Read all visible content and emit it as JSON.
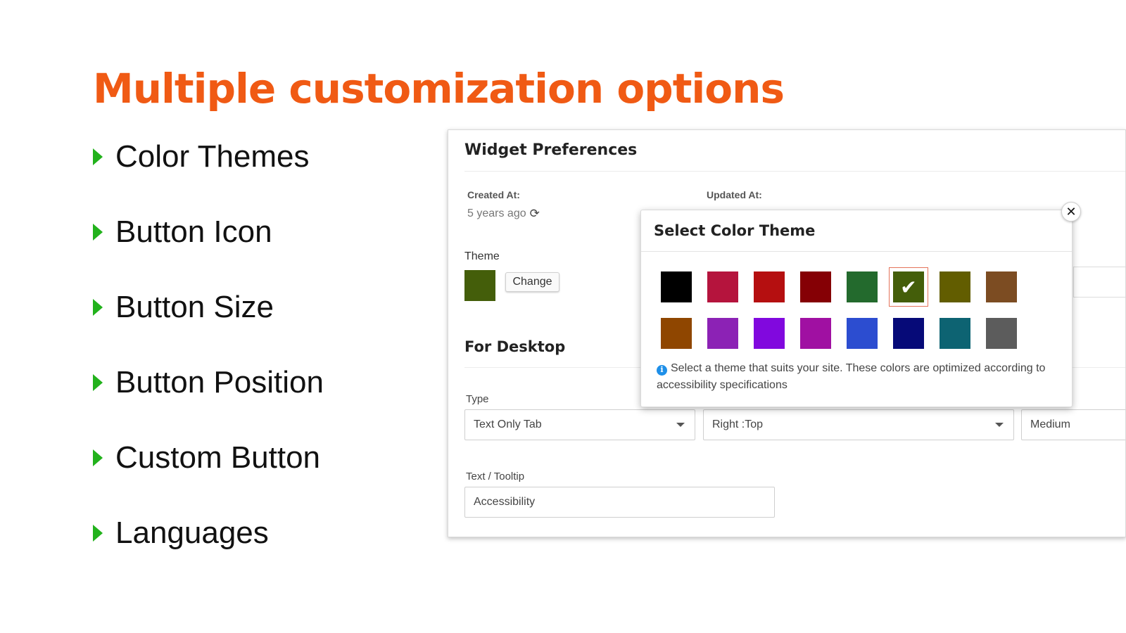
{
  "headline": "Multiple customization options",
  "features": [
    "Color Themes",
    "Button Icon",
    "Button Size",
    "Button Position",
    "Custom Button",
    "Languages"
  ],
  "panel": {
    "title": "Widget Preferences",
    "created_label": "Created At:",
    "created_value": "5 years ago",
    "updated_label": "Updated At:",
    "theme_label": "Theme",
    "current_theme_color": "#445e0a",
    "change_label": "Change",
    "section_title": "For Desktop",
    "type_label": "Type",
    "type_value": "Text Only Tab",
    "position_value": "Right :Top",
    "size_value": "Medium",
    "tooltip_label": "Text / Tooltip",
    "tooltip_value": "Accessibility"
  },
  "modal": {
    "title": "Select Color Theme",
    "close_icon": "close-icon",
    "colors": [
      "#000000",
      "#b5143d",
      "#b50f10",
      "#850005",
      "#236a2d",
      "#445e0a",
      "#625d00",
      "#7c4c22",
      "#8f4600",
      "#8c22b5",
      "#8108de",
      "#a010a2",
      "#2c4dd0",
      "#060a78",
      "#0d6372",
      "#5c5c5c"
    ],
    "selected_index": 5,
    "note": "Select a theme that suits your site. These colors are optimized according to accessibility specifications"
  },
  "colors": {
    "headline": "#f05a14",
    "bullet": "#22b21c",
    "info": "#1e8fe8"
  }
}
